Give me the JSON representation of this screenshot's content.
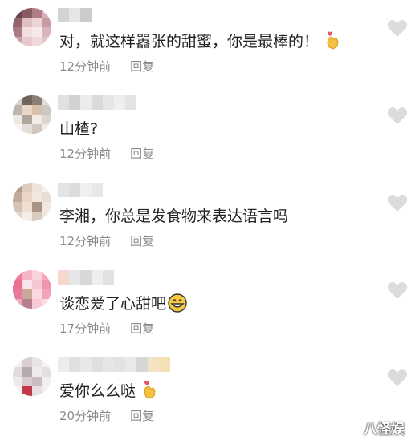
{
  "comments": [
    {
      "text": "对，就这样嚣张的甜蜜，你是最棒的！",
      "emoji": "heart-hand-emoji",
      "time": "12分钟前",
      "reply": "回复"
    },
    {
      "text": "山楂?",
      "emoji": "",
      "time": "12分钟前",
      "reply": "回复"
    },
    {
      "text": "李湘，你总是发食物来表达语言吗",
      "emoji": "",
      "time": "12分钟前",
      "reply": "回复"
    },
    {
      "text": "谈恋爱了心甜吧",
      "emoji": "grinning-face-emoji",
      "time": "17分钟前",
      "reply": "回复"
    },
    {
      "text": "爱你么么哒",
      "emoji": "heart-hand-emoji",
      "time": "20分钟前",
      "reply": "回复"
    }
  ],
  "icons": {
    "like": "heart-outline-icon"
  },
  "colors": {
    "text": "#222222",
    "meta": "#8a8a8a",
    "heart": "#dcdcdc"
  },
  "watermark": "八怪娱"
}
